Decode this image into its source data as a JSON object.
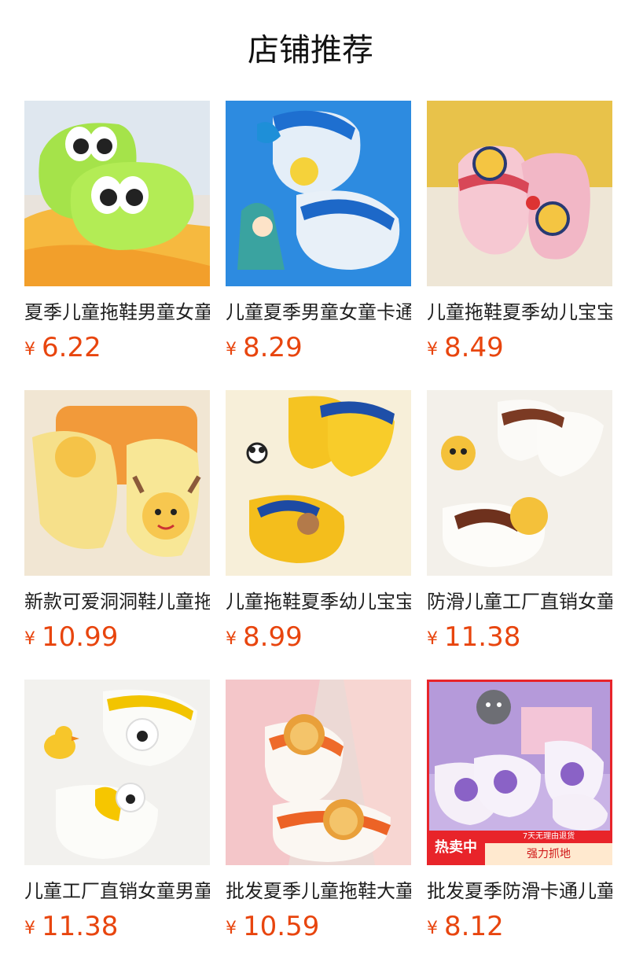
{
  "header": {
    "title": "店铺推荐"
  },
  "currency_symbol": "¥",
  "products": [
    {
      "name": "夏季儿童拖鞋男童女童",
      "price": "6.22",
      "thumb": "green-slides"
    },
    {
      "name": "儿童夏季男童女童卡通",
      "price": "8.29",
      "thumb": "blue-clogs"
    },
    {
      "name": "儿童拖鞋夏季幼儿宝宝",
      "price": "8.49",
      "thumb": "pink-clogs"
    },
    {
      "name": "新款可爱洞洞鞋儿童拖",
      "price": "10.99",
      "thumb": "yellow-deer-clogs"
    },
    {
      "name": "儿童拖鞋夏季幼儿宝宝",
      "price": "8.99",
      "thumb": "yellow-king-clogs"
    },
    {
      "name": "防滑儿童工厂直销女童",
      "price": "11.38",
      "thumb": "white-deer-clogs"
    },
    {
      "name": "儿童工厂直销女童男童",
      "price": "11.38",
      "thumb": "white-duck-clogs"
    },
    {
      "name": "批发夏季儿童拖鞋大童",
      "price": "10.59",
      "thumb": "lion-slides"
    },
    {
      "name": "批发夏季防滑卡通儿童",
      "price": "8.12",
      "thumb": "purple-clogs"
    }
  ],
  "badge": {
    "hot": "热卖中",
    "return_policy": "7天无理由退货",
    "slogan": "强力抓地"
  },
  "colors": {
    "price": "#e8450e",
    "hot_badge": "#e8242a"
  }
}
